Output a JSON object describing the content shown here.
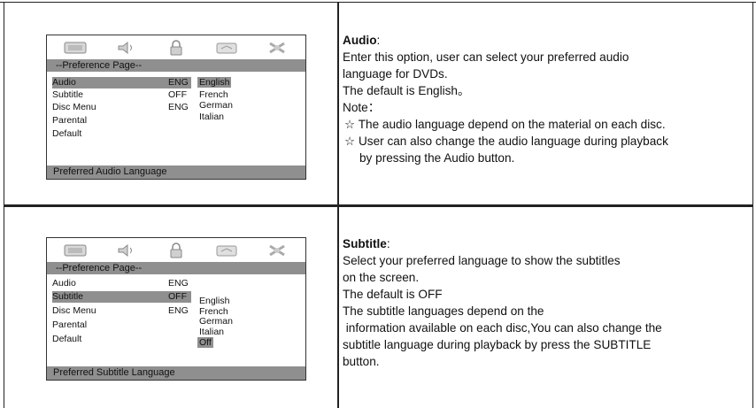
{
  "osd": {
    "page_title": "--Preference Page--",
    "menu_items": [
      "Audio",
      "Subtitle",
      "Disc Menu",
      "Parental",
      "Default"
    ],
    "icons": [
      "tv-display-icon",
      "speaker-icon",
      "lock-icon",
      "preference-icon",
      "exit-icon"
    ]
  },
  "audio_panel": {
    "values": [
      "ENG",
      "OFF",
      "ENG",
      "",
      ""
    ],
    "options": [
      "English",
      "French",
      "German",
      "Italian"
    ],
    "selected_option": "English",
    "status": "Preferred Audio Language"
  },
  "subtitle_panel": {
    "values": [
      "ENG",
      "OFF",
      "ENG",
      "",
      ""
    ],
    "options": [
      "English",
      "French",
      "German",
      "Italian",
      "Off"
    ],
    "selected_option": "Off",
    "status": "Preferred Subtitle Language"
  },
  "audio_desc": {
    "heading": "Audio",
    "heading_suffix": ":",
    "lines": [
      "Enter this option, user can select your preferred audio",
      "language for DVDs.",
      "The default is English。",
      "Note：",
      "☆ The audio language depend on the material on each disc.",
      "☆ User can also change the audio language during playback",
      "by pressing the Audio button."
    ]
  },
  "subtitle_desc": {
    "heading": "Subtitle",
    "heading_suffix": ":",
    "lines": [
      "Select your preferred language to show the subtitles",
      "on the screen.",
      "The default is OFF",
      "The subtitle languages depend on the",
      " information available on each disc,You can also change the",
      "subtitle language during playback by press the SUBTITLE",
      "button."
    ]
  }
}
